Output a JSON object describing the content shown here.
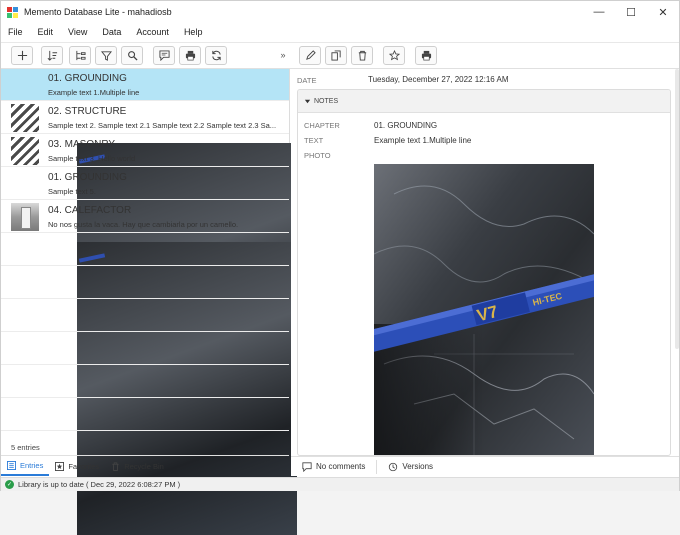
{
  "window": {
    "title": "Memento Database Lite - mahadiosb",
    "minimize_glyph": "—",
    "maximize_glyph": "☐",
    "close_glyph": "✕"
  },
  "menu": [
    "File",
    "Edit",
    "View",
    "Data",
    "Account",
    "Help"
  ],
  "toolbar": {
    "left_icons": [
      "add-icon",
      "sort-icon",
      "group-icon",
      "filter-icon",
      "search-icon",
      "comment-icon",
      "print-icon",
      "sync-icon"
    ],
    "collapse_glyph": "»",
    "right_icons": [
      "edit-icon",
      "copy-icon",
      "delete-icon",
      "favorite-icon",
      "print-icon"
    ]
  },
  "entries": [
    {
      "title": "01. GROUNDING",
      "desc": "Example text 1.Multiple line",
      "thumb": "photo",
      "selected": true
    },
    {
      "title": "02. STRUCTURE",
      "desc": "Sample text 2. Sample text 2.1 Sample text 2.2 Sample text 2.3 Sa...",
      "thumb": "stripes",
      "selected": false
    },
    {
      "title": "03. MASONRY",
      "desc": "Sample text 3. Hello world",
      "thumb": "stripes",
      "selected": false
    },
    {
      "title": "01. GROUNDING",
      "desc": "Sample text 5.",
      "thumb": "photo",
      "selected": false
    },
    {
      "title": "04. CALEFACTOR",
      "desc": "No nos gusta la vaca. Hay que cambiarla por un camello.",
      "thumb": "device",
      "selected": false
    }
  ],
  "entry_count": "5 entries",
  "bottom_tabs": [
    {
      "label": "Entries",
      "icon": "list-icon",
      "active": true
    },
    {
      "label": "Favorites",
      "icon": "star-box-icon",
      "active": false
    },
    {
      "label": "Recycle Bin",
      "icon": "trash-icon",
      "active": false
    }
  ],
  "detail": {
    "date_label": "DATE",
    "date_value": "Tuesday, December 27, 2022 12:16 AM",
    "notes_header": "NOTES",
    "chapter_label": "CHAPTER",
    "chapter_value": "01. GROUNDING",
    "text_label": "TEXT",
    "text_value": "Example text 1.Multiple line",
    "photo_label": "PHOTO"
  },
  "footer": {
    "comments": "No comments",
    "versions": "Versions"
  },
  "status": {
    "text": "Library is up to date ( Dec 29, 2022 6:08:27 PM )",
    "color": "#2a9d4a"
  },
  "colors": {
    "selected_row": "#b4e4f6",
    "accent": "#2a7bd8"
  }
}
